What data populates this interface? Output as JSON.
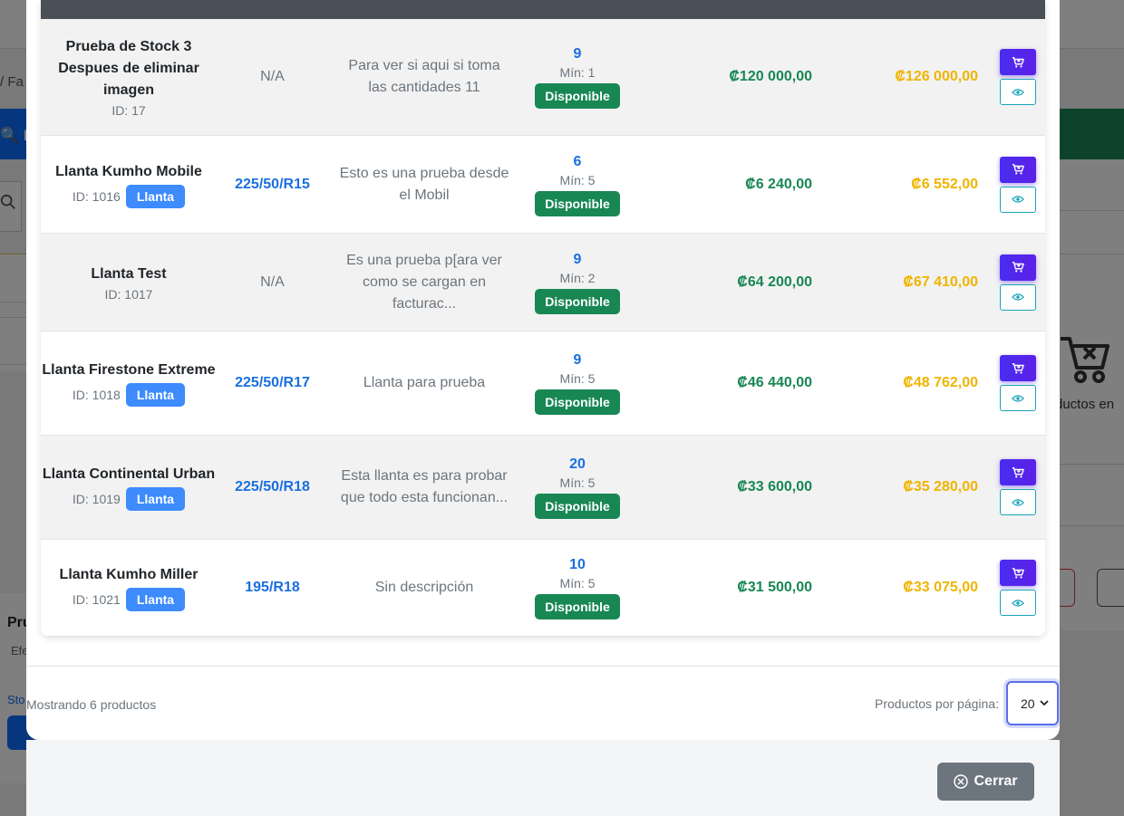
{
  "background": {
    "breadcrumb": "/  Fa",
    "blue_button": "🔍 B",
    "products_text": "ductos en",
    "left_card": {
      "title": "Pru",
      "subtitle": "Efe",
      "stock": "Sto"
    }
  },
  "products": [
    {
      "name": "Prueba de Stock 3 Despues de eliminar imagen",
      "id": "ID: 17",
      "type": "",
      "medida": "N/A",
      "description": "Para ver si aqui si toma las cantidades 11",
      "stock": "9",
      "min": "Mín: 1",
      "status": "Disponible",
      "price": "₡120 000,00",
      "price_iva": "₡126 000,00"
    },
    {
      "name": "Llanta Kumho Mobile",
      "id": "ID: 1016",
      "type": "Llanta",
      "medida": "225/50/R15",
      "description": "Esto es una prueba desde el Mobil",
      "stock": "6",
      "min": "Mín: 5",
      "status": "Disponible",
      "price": "₡6 240,00",
      "price_iva": "₡6 552,00"
    },
    {
      "name": "Llanta Test",
      "id": "ID: 1017",
      "type": "",
      "medida": "N/A",
      "description": "Es una prueba p[ara ver como se cargan en facturac...",
      "stock": "9",
      "min": "Mín: 2",
      "status": "Disponible",
      "price": "₡64 200,00",
      "price_iva": "₡67 410,00"
    },
    {
      "name": "Llanta Firestone Extreme",
      "id": "ID: 1018",
      "type": "Llanta",
      "medida": "225/50/R17",
      "description": "Llanta para prueba",
      "stock": "9",
      "min": "Mín: 5",
      "status": "Disponible",
      "price": "₡46 440,00",
      "price_iva": "₡48 762,00"
    },
    {
      "name": "Llanta Continental Urban",
      "id": "ID: 1019",
      "type": "Llanta",
      "medida": "225/50/R18",
      "description": "Esta llanta es para probar que todo esta funcionan...",
      "stock": "20",
      "min": "Mín: 5",
      "status": "Disponible",
      "price": "₡33 600,00",
      "price_iva": "₡35 280,00"
    },
    {
      "name": "Llanta Kumho Miller",
      "id": "ID: 1021",
      "type": "Llanta",
      "medida": "195/R18",
      "description": "Sin descripción",
      "stock": "10",
      "min": "Mín: 5",
      "status": "Disponible",
      "price": "₡31 500,00",
      "price_iva": "₡33 075,00"
    }
  ],
  "footer": {
    "showing": "Mostrando 6 productos",
    "per_page_label": "Productos por página:",
    "per_page_value": "20",
    "close_label": "Cerrar"
  },
  "icons": {
    "cart": "cart-icon",
    "eye": "eye-icon",
    "close": "close-circle-icon",
    "chevron": "chevron-down-icon"
  },
  "colors": {
    "primary": "#1a6fe0",
    "success": "#198754",
    "warning": "#f0b400",
    "cart_button": "#4a2cf0",
    "secondary": "#6c757d"
  }
}
